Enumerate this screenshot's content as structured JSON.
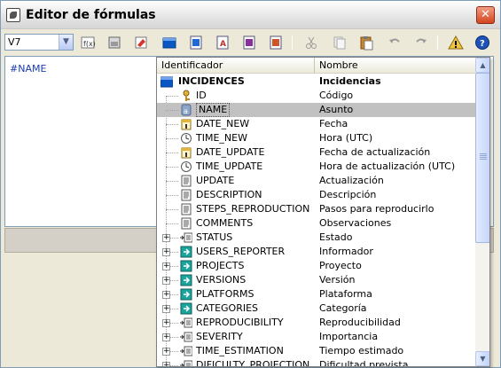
{
  "window": {
    "title": "Editor de fórmulas",
    "close_glyph": "✕"
  },
  "toolbar": {
    "cell_select_value": "V7",
    "buttons": [
      "function-icon",
      "field-icon",
      "eraser-icon",
      "table-icon",
      "copy-table-icon",
      "text-icon",
      "number-icon",
      "date-icon",
      "cut-icon",
      "copy-icon",
      "paste-icon",
      "undo-icon",
      "redo-icon",
      "warning-icon",
      "help-icon"
    ]
  },
  "editor": {
    "formula": "#NAME"
  },
  "dropdown": {
    "header": {
      "col1": "Identificador",
      "col2": "Nombre"
    },
    "rows": [
      {
        "id": "INCIDENCES",
        "name": "Incidencias",
        "icon": "table-icon",
        "kind": "root"
      },
      {
        "id": "ID",
        "name": "Código",
        "icon": "key-icon",
        "kind": "field"
      },
      {
        "id": "NAME",
        "name": "Asunto",
        "icon": "text-field-icon",
        "kind": "field",
        "selected": true
      },
      {
        "id": "DATE_NEW",
        "name": "Fecha",
        "icon": "calendar-icon",
        "kind": "field"
      },
      {
        "id": "TIME_NEW",
        "name": "Hora (UTC)",
        "icon": "clock-icon",
        "kind": "field"
      },
      {
        "id": "DATE_UPDATE",
        "name": "Fecha de actualización",
        "icon": "calendar-icon",
        "kind": "field"
      },
      {
        "id": "TIME_UPDATE",
        "name": "Hora de actualización (UTC)",
        "icon": "clock-icon",
        "kind": "field"
      },
      {
        "id": "UPDATE",
        "name": "Actualización",
        "icon": "document-icon",
        "kind": "field"
      },
      {
        "id": "DESCRIPTION",
        "name": "Descripción",
        "icon": "document-icon",
        "kind": "field"
      },
      {
        "id": "STEPS_REPRODUCTION",
        "name": "Pasos para reproducirlo",
        "icon": "document-icon",
        "kind": "field"
      },
      {
        "id": "COMMENTS",
        "name": "Observaciones",
        "icon": "document-icon",
        "kind": "field"
      },
      {
        "id": "STATUS",
        "name": "Estado",
        "icon": "key-link-icon",
        "kind": "link"
      },
      {
        "id": "USERS_REPORTER",
        "name": "Informador",
        "icon": "link-icon",
        "kind": "link"
      },
      {
        "id": "PROJECTS",
        "name": "Proyecto",
        "icon": "link-icon",
        "kind": "link"
      },
      {
        "id": "VERSIONS",
        "name": "Versión",
        "icon": "link-icon",
        "kind": "link"
      },
      {
        "id": "PLATFORMS",
        "name": "Plataforma",
        "icon": "link-icon",
        "kind": "link"
      },
      {
        "id": "CATEGORIES",
        "name": "Categoría",
        "icon": "link-icon",
        "kind": "link"
      },
      {
        "id": "REPRODUCIBILITY",
        "name": "Reproducibilidad",
        "icon": "key-link-icon",
        "kind": "link"
      },
      {
        "id": "SEVERITY",
        "name": "Importancia",
        "icon": "key-link-icon",
        "kind": "link"
      },
      {
        "id": "TIME_ESTIMATION",
        "name": "Tiempo estimado",
        "icon": "key-link-icon",
        "kind": "link"
      },
      {
        "id": "DIFICULTY_PROJECTION",
        "name": "Dificultad prevista",
        "icon": "key-link-icon",
        "kind": "link"
      }
    ]
  },
  "colors": {
    "selection": "#c1c1c1",
    "formula_text": "#1a3cb0",
    "accent": "#0a56c3"
  }
}
